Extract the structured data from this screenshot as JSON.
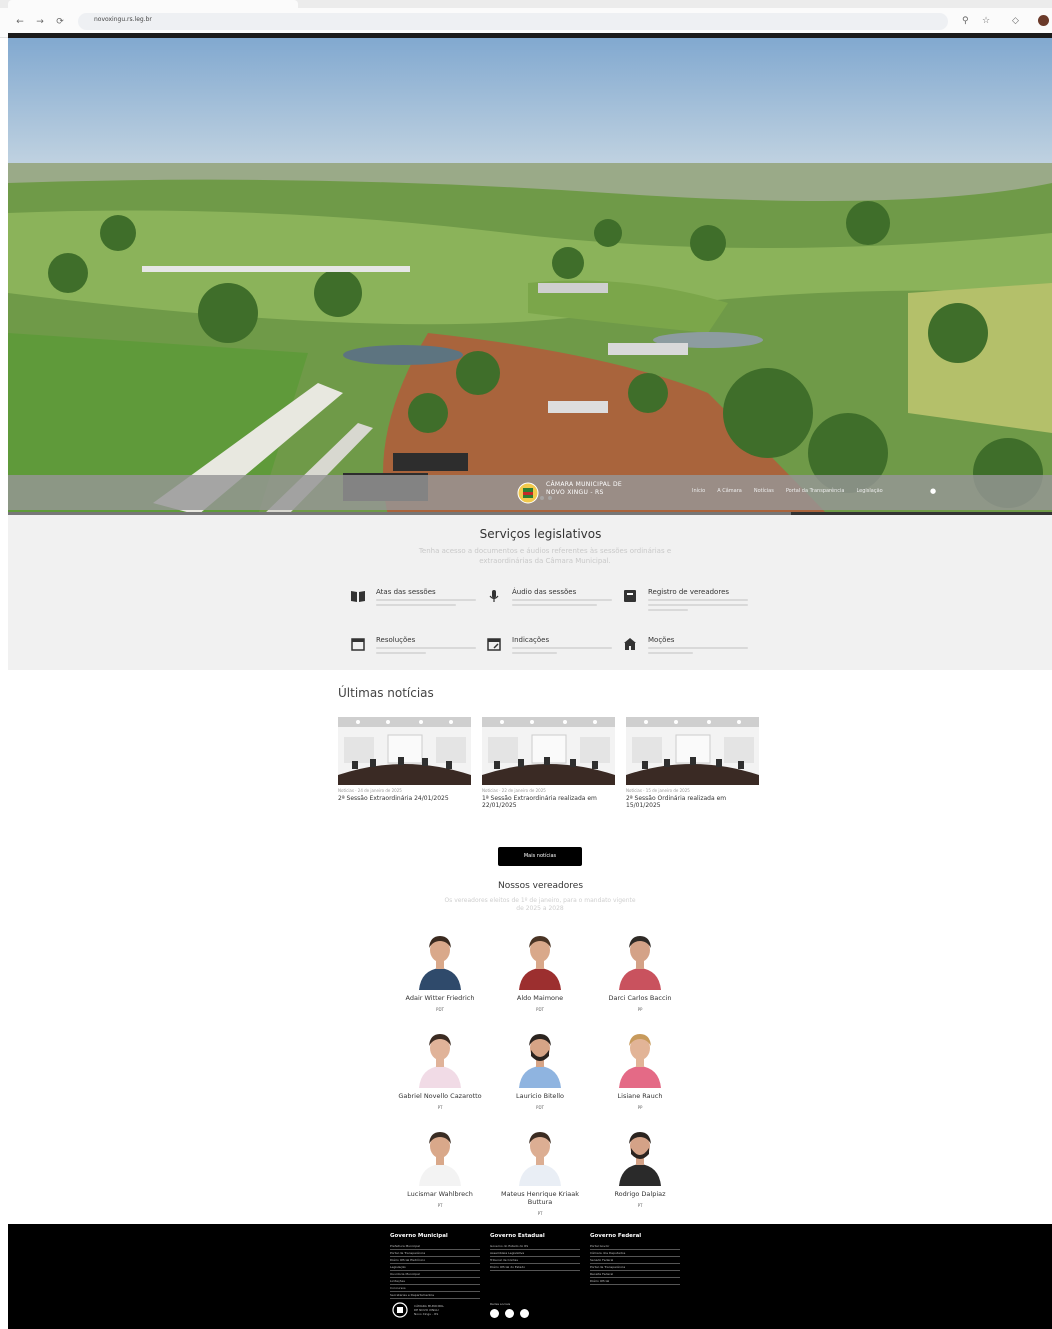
{
  "browser": {
    "url": "novoxingu.rs.leg.br",
    "back": "←",
    "forward": "→",
    "reload": "⟳",
    "zoom_icon": "zoom-icon",
    "star_icon": "star-icon",
    "extensions_icon": "extensions-icon"
  },
  "header": {
    "logo_line1": "CÂMARA MUNICIPAL DE",
    "logo_line2": "NOVO XINGU - RS",
    "menu": [
      "Início",
      "A Câmara",
      "Notícias",
      "Portal da Transparência",
      "Legislação"
    ]
  },
  "services": {
    "title": "Serviços legislativos",
    "subtitle": "Tenha acesso a documentos e áudios referentes às sessões ordinárias e extraordinárias da Câmara Municipal.",
    "items": [
      {
        "title": "Atas das sessões",
        "icon": "book-icon"
      },
      {
        "title": "Áudio das sessões",
        "icon": "microphone-icon"
      },
      {
        "title": "Registro de vereadores",
        "icon": "register-icon"
      },
      {
        "title": "Resoluções",
        "icon": "calendar-icon"
      },
      {
        "title": "Indicações",
        "icon": "calendar-edit-icon"
      },
      {
        "title": "Moções",
        "icon": "building-icon"
      }
    ]
  },
  "news": {
    "title": "Últimas notícias",
    "items": [
      {
        "meta": "Notícias · 24 de janeiro de 2025",
        "headline": "2ª Sessão Extraordinária 24/01/2025"
      },
      {
        "meta": "Notícias · 22 de janeiro de 2025",
        "headline": "1ª Sessão Extraordinária realizada em 22/01/2025"
      },
      {
        "meta": "Notícias · 15 de janeiro de 2025",
        "headline": "2ª Sessão Ordinária realizada em 15/01/2025"
      }
    ],
    "more_label": "Mais notícias"
  },
  "council": {
    "title": "Nossos vereadores",
    "subtitle": "Os vereadores eleitos de 1º de janeiro, para o mandato vigente de 2025 a 2028",
    "members": [
      {
        "name": "Adair Witter Friedrich",
        "party": "PDT",
        "shirt": "#2f4a6b",
        "skin": "#d9a88a",
        "hair": "#3a2a1f",
        "beard": false
      },
      {
        "name": "Aldo Maimone",
        "party": "PDT",
        "shirt": "#9c2f2f",
        "skin": "#d9a88a",
        "hair": "#4a3424",
        "beard": false
      },
      {
        "name": "Darci Carlos Baccin",
        "party": "PP",
        "shirt": "#c9525e",
        "skin": "#d4a287",
        "hair": "#2f2a26",
        "beard": false
      },
      {
        "name": "Gabriel Novello Cazarotto",
        "party": "PT",
        "shirt": "#f1dbe6",
        "skin": "#e0b399",
        "hair": "#3b2b22",
        "beard": false
      },
      {
        "name": "Lauricio Bitello",
        "party": "PDT",
        "shirt": "#8fb4e0",
        "skin": "#d6a486",
        "hair": "#2b2420",
        "beard": true
      },
      {
        "name": "Lisiane Rauch",
        "party": "PP",
        "shirt": "#e46a86",
        "skin": "#e2b497",
        "hair": "#c79a5c",
        "beard": false
      },
      {
        "name": "Lucismar Wahlbrech",
        "party": "PT",
        "shirt": "#f3f3f3",
        "skin": "#d9a88a",
        "hair": "#3a2d24",
        "beard": false
      },
      {
        "name": "Mateus Henrique Kriaak Buttura",
        "party": "PT",
        "shirt": "#e9eef5",
        "skin": "#dcae93",
        "hair": "#3b2c22",
        "beard": false
      },
      {
        "name": "Rodrigo Dalpiaz",
        "party": "PT",
        "shirt": "#2a2a2a",
        "skin": "#d4a287",
        "hair": "#2b2420",
        "beard": true
      }
    ]
  },
  "footer": {
    "columns": [
      {
        "title": "Governo Municipal",
        "links": [
          "Prefeitura Municipal",
          "Portal da Transparência",
          "Diário Oficial Eletrônico",
          "Legislação",
          "Ouvidoria Municipal",
          "Licitações",
          "Concursos",
          "Secretarias e Departamentos"
        ]
      },
      {
        "title": "Governo Estadual",
        "links": [
          "Governo do Estado do RS",
          "Assembleia Legislativa",
          "Tribunal de Contas",
          "Diário Oficial do Estado"
        ]
      },
      {
        "title": "Governo Federal",
        "links": [
          "Portal Gov.br",
          "Câmara dos Deputados",
          "Senado Federal",
          "Portal da Transparência",
          "Receita Federal",
          "Diário Oficial"
        ]
      }
    ],
    "logo_line1": "CÂMARA MUNICIPAL",
    "logo_line2": "DE NOVO XINGU",
    "logo_line3": "Novo Xingu - RS",
    "social_label": "Redes sociais",
    "social_icons": [
      "facebook-icon",
      "instagram-icon",
      "youtube-icon"
    ]
  },
  "colors": {
    "accent": "#000000",
    "section_bg": "#f1f1f1",
    "footer_bg": "#000000"
  },
  "slider": {
    "slides": 3,
    "progress": 0.75
  }
}
